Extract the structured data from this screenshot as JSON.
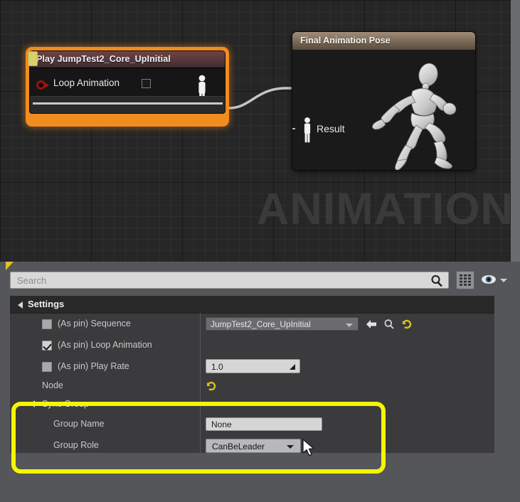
{
  "graph": {
    "watermark": "ANIMATION",
    "play_node": {
      "title": "Play JumpTest2_Core_UpInitial",
      "pin_label": "Loop Animation",
      "pin_icon": "pose-pin-icon",
      "checkbox_checked": false,
      "border_color": "#f28c1e"
    },
    "final_node": {
      "title": "Final Animation Pose",
      "result_label": "Result",
      "result_icon": "pose-pin-icon",
      "preview_icon": "mannequin-running-icon"
    }
  },
  "details": {
    "search": {
      "placeholder": "Search",
      "value": "",
      "search_icon": "search-icon",
      "grid_icon": "grid-view-icon",
      "eye_icon": "eye-visibility-icon",
      "chevron_icon": "chevron-down-icon"
    },
    "settings_section": {
      "label": "Settings",
      "rows": [
        {
          "id": "sequence",
          "checkbox_prefix": "(As pin)",
          "label": "Sequence",
          "checked": false,
          "value": "JumpTest2_Core_UpInitial",
          "control": "combo",
          "icons": [
            "chevron-down-icon",
            "browse-arrow-icon",
            "find-icon",
            "reset-icon"
          ]
        },
        {
          "id": "loop-animation",
          "checkbox_prefix": "(As pin)",
          "label": "Loop Animation",
          "checked": true,
          "value": "",
          "control": "none",
          "icons": []
        },
        {
          "id": "play-rate",
          "checkbox_prefix": "(As pin)",
          "label": "Play Rate",
          "checked": false,
          "value": "1.0",
          "control": "numeric",
          "icons": [
            "spinner-icon"
          ]
        },
        {
          "id": "node",
          "checkbox_prefix": "",
          "label": "Node",
          "checked": null,
          "value": "",
          "control": "reset-only",
          "icons": [
            "reset-icon"
          ]
        }
      ]
    },
    "sync_group_section": {
      "label": "Sync Group",
      "highlight_color": "#f5f500",
      "rows": [
        {
          "id": "group-name",
          "label": "Group Name",
          "value": "None",
          "control": "text"
        },
        {
          "id": "group-role",
          "label": "Group Role",
          "value": "CanBeLeader",
          "control": "dropdown"
        }
      ]
    }
  },
  "cursor": {
    "icon": "mouse-pointer-icon"
  }
}
